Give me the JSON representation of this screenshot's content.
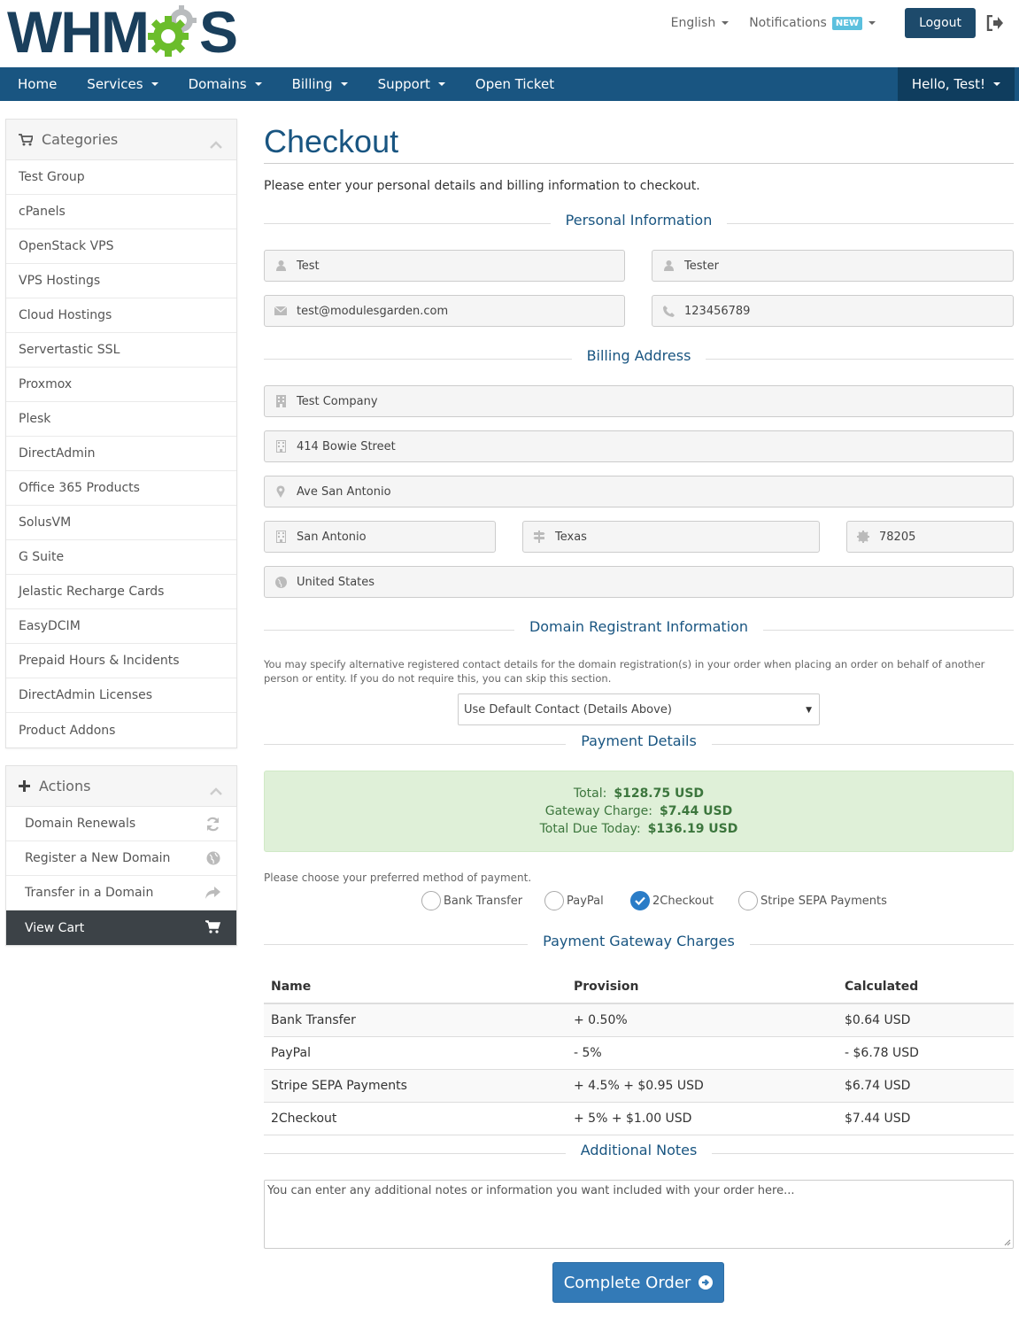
{
  "header": {
    "logo_text_left": "WHM",
    "logo_text_right": "S",
    "language": "English",
    "notifications": "Notifications",
    "notifications_badge": "NEW",
    "logout": "Logout"
  },
  "nav": {
    "items": [
      "Home",
      "Services",
      "Domains",
      "Billing",
      "Support",
      "Open Ticket"
    ],
    "user": "Hello, Test!"
  },
  "sidebar": {
    "categories_title": "Categories",
    "categories": [
      "Test Group",
      "cPanels",
      "OpenStack VPS",
      "VPS Hostings",
      "Cloud Hostings",
      "Servertastic SSL",
      "Proxmox",
      "Plesk",
      "DirectAdmin",
      "Office 365 Products",
      "SolusVM",
      "G Suite",
      "Jelastic Recharge Cards",
      "EasyDCIM",
      "Prepaid Hours & Incidents",
      "DirectAdmin Licenses",
      "Product Addons"
    ],
    "actions_title": "Actions",
    "actions": [
      {
        "label": "Domain Renewals",
        "icon": "refresh-icon"
      },
      {
        "label": "Register a New Domain",
        "icon": "globe-icon"
      },
      {
        "label": "Transfer in a Domain",
        "icon": "share-icon"
      },
      {
        "label": "View Cart",
        "icon": "cart-icon"
      }
    ]
  },
  "main": {
    "title": "Checkout",
    "intro": "Please enter your personal details and billing information to checkout.",
    "personal_title": "Personal Information",
    "first_name": "Test",
    "last_name": "Tester",
    "email": "test@modulesgarden.com",
    "phone": "123456789",
    "billing_title": "Billing Address",
    "company": "Test Company",
    "address1": "414 Bowie Street",
    "address2": "Ave San Antonio",
    "city": "San Antonio",
    "state": "Texas",
    "postcode": "78205",
    "country": "United States",
    "registrant_title": "Domain Registrant Information",
    "registrant_desc": "You may specify alternative registered contact details for the domain registration(s) in your order when placing an order on behalf of another person or entity. If you do not require this, you can skip this section.",
    "registrant_select": "Use Default Contact (Details Above)",
    "payment_title": "Payment Details",
    "total_label": "Total:",
    "total_value": "$128.75 USD",
    "gateway_label": "Gateway Charge:",
    "gateway_value": "$7.44 USD",
    "due_label": "Total Due Today:",
    "due_value": "$136.19 USD",
    "payment_prompt": "Please choose your preferred method of payment.",
    "methods": [
      "Bank Transfer",
      "PayPal",
      "2Checkout",
      "Stripe SEPA Payments"
    ],
    "selected_method": "2Checkout",
    "charges_title": "Payment Gateway Charges",
    "charges_headers": [
      "Name",
      "Provision",
      "Calculated"
    ],
    "charges_rows": [
      [
        "Bank Transfer",
        "+ 0.50%",
        "$0.64 USD"
      ],
      [
        "PayPal",
        "- 5%",
        "- $6.78 USD"
      ],
      [
        "Stripe SEPA Payments",
        "+ 4.5% + $0.95 USD",
        "$6.74 USD"
      ],
      [
        "2Checkout",
        "+ 5% + $1.00 USD",
        "$7.44 USD"
      ]
    ],
    "notes_title": "Additional Notes",
    "notes_placeholder": "You can enter any additional notes or information you want included with your order here...",
    "complete_button": "Complete Order"
  },
  "colors": {
    "brand": "#195581",
    "success_bg": "#dff0d8",
    "button": "#337ab7"
  }
}
